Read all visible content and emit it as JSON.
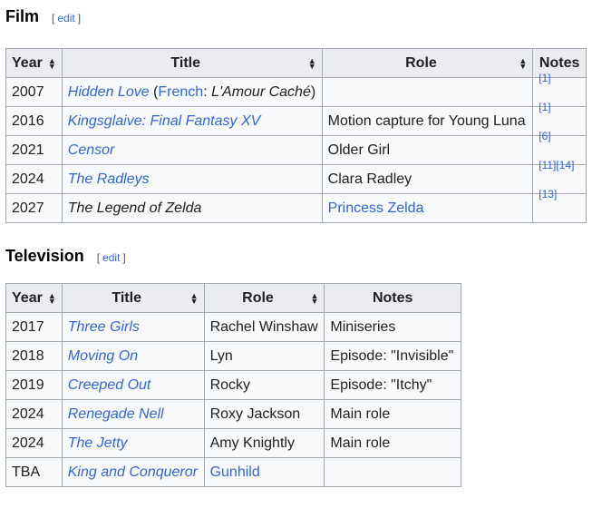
{
  "film": {
    "heading": "Film",
    "edit_open": "[",
    "edit_label": "edit",
    "edit_close": "]",
    "headers": {
      "year": "Year",
      "title": "Title",
      "role": "Role",
      "notes": "Notes"
    },
    "rows": [
      {
        "year": "2007",
        "title": "Hidden Love",
        "title_extra_open": " (",
        "lang": "French",
        "lang_sep": ": ",
        "alt_title": "L'Amour Caché",
        "title_extra_close": ")",
        "role": "",
        "notes": "[1]"
      },
      {
        "year": "2016",
        "title": "Kingsglaive: Final Fantasy XV",
        "role": "Motion capture for Young Luna",
        "notes": "[1]"
      },
      {
        "year": "2021",
        "title": "Censor",
        "role": "Older Girl",
        "notes": "[6]"
      },
      {
        "year": "2024",
        "title": "The Radleys",
        "role": "Clara Radley",
        "notes": "[11][14]"
      },
      {
        "year": "2027",
        "title": "The Legend of Zelda",
        "role": "Princess Zelda",
        "notes": "[13]"
      }
    ]
  },
  "television": {
    "heading": "Television",
    "edit_open": "[",
    "edit_label": "edit",
    "edit_close": "]",
    "headers": {
      "year": "Year",
      "title": "Title",
      "role": "Role",
      "notes": "Notes"
    },
    "rows": [
      {
        "year": "2017",
        "title": "Three Girls",
        "role": "Rachel Winshaw",
        "notes": "Miniseries"
      },
      {
        "year": "2018",
        "title": "Moving On",
        "role": "Lyn",
        "notes": "Episode: \"Invisible\""
      },
      {
        "year": "2019",
        "title": "Creeped Out",
        "role": "Rocky",
        "notes": "Episode: \"Itchy\""
      },
      {
        "year": "2024",
        "title": "Renegade Nell",
        "role": "Roxy Jackson",
        "notes": "Main role"
      },
      {
        "year": "2024",
        "title": "The Jetty",
        "role": "Amy Knightly",
        "notes": "Main role"
      },
      {
        "year": "TBA",
        "title": "King and Conqueror",
        "role": "Gunhild",
        "notes": ""
      }
    ]
  },
  "colors": {
    "link": "#3366cc",
    "header_bg": "#eaecf0",
    "cell_bg": "#f8f9fa",
    "border": "#a2a9b1"
  },
  "icons": {
    "sort": "sort-arrows-icon"
  }
}
